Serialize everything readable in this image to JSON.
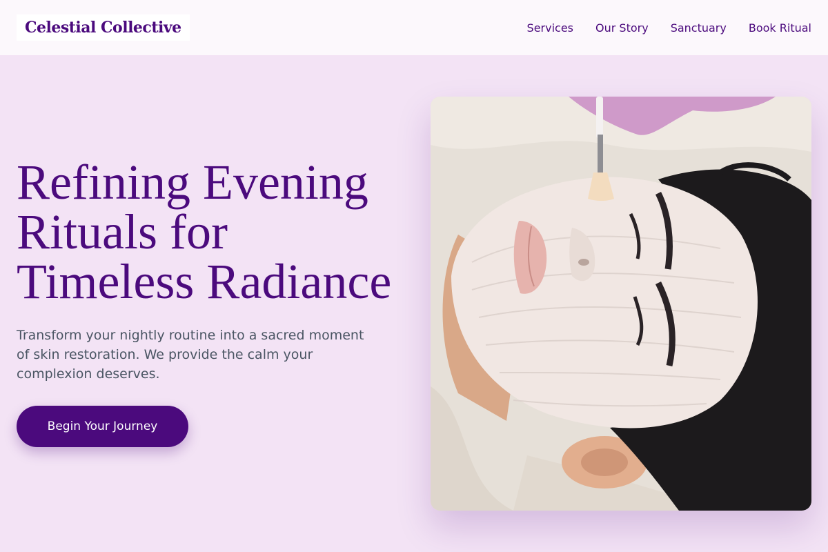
{
  "header": {
    "brand": "Celestial Collective",
    "nav": [
      {
        "label": "Services"
      },
      {
        "label": "Our Story"
      },
      {
        "label": "Sanctuary"
      },
      {
        "label": "Book Ritual"
      }
    ]
  },
  "hero": {
    "title_lines": [
      "Refining Evening",
      "Rituals for",
      "Timeless Radiance"
    ],
    "subtitle": "Transform your nightly routine into a sacred moment of skin restoration. We provide the calm your complexion deserves.",
    "cta_label": "Begin Your Journey",
    "image_subject": "facial-mask-treatment-photo"
  },
  "colors": {
    "brand": "#4b0a7d",
    "page_bg": "#f3e3f5",
    "header_bg": "#fcf8fc",
    "body_text": "#4a5563"
  }
}
